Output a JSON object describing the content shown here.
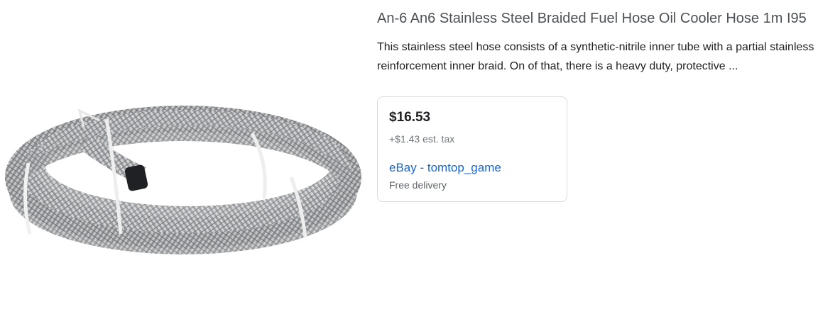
{
  "product": {
    "title": "An-6 An6 Stainless Steel Braided Fuel Hose Oil Cooler Hose 1m I95",
    "description_line1": "This stainless steel hose consists of a synthetic-nitrile inner tube with a partial stainless",
    "description_line2": "reinforcement inner braid. On of that, there is a heavy duty, protective ...",
    "image_icon": "braided-hose-image"
  },
  "offer": {
    "price": "$16.53",
    "tax": "+$1.43 est. tax",
    "seller": "eBay - tomtop_game",
    "delivery": "Free delivery"
  },
  "colors": {
    "link": "#1967d2",
    "title": "#4d5156",
    "border": "#dadce0"
  }
}
